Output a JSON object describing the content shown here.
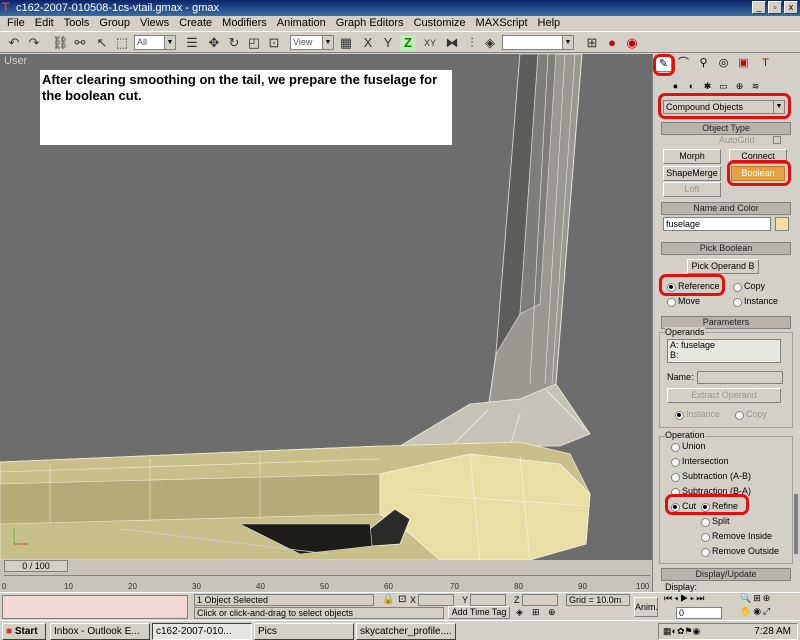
{
  "window": {
    "title": "c162-2007-010508-1cs-vtail.gmax - gmax",
    "minimize": "_",
    "maximize": "▫",
    "close": "x"
  },
  "menu": [
    "File",
    "Edit",
    "Tools",
    "Group",
    "Views",
    "Create",
    "Modifiers",
    "Animation",
    "Graph Editors",
    "Customize",
    "MAXScript",
    "Help"
  ],
  "toolbar": {
    "selection_filter": "All",
    "ref_coord": "View",
    "axis_labels": [
      "X",
      "Y",
      "Z",
      "XY"
    ]
  },
  "viewport": {
    "label": "User",
    "caption": "After clearing smoothing on the tail, we prepare the fuselage for the boolean cut."
  },
  "command_panel": {
    "category": "Compound Objects",
    "object_type": {
      "title": "Object Type",
      "autogrid": "AutoGrid",
      "buttons": [
        "Morph",
        "Connect",
        "ShapeMerge",
        "Boolean",
        "Loft"
      ]
    },
    "name_color": {
      "title": "Name and Color",
      "name": "fuselage"
    },
    "pick_boolean": {
      "title": "Pick Boolean",
      "pick_button": "Pick Operand B",
      "options": [
        "Reference",
        "Copy",
        "Move",
        "Instance"
      ]
    },
    "parameters": {
      "title": "Parameters",
      "operands_label": "Operands",
      "operands": [
        "A: fuselage",
        "B:"
      ],
      "name_label": "Name:",
      "extract_button": "Extract Operand",
      "extract_options": [
        "Instance",
        "Copy"
      ],
      "operation_label": "Operation",
      "operations": [
        "Union",
        "Intersection",
        "Subtraction (A-B)",
        "Subtraction (B-A)"
      ],
      "cut_label": "Cut",
      "cut_options": [
        "Refine",
        "Split",
        "Remove Inside",
        "Remove Outside"
      ]
    },
    "display_update": {
      "title": "Display/Update",
      "display_label": "Display:"
    }
  },
  "timeline": {
    "frame": "0 / 100",
    "ticks": [
      "0",
      "10",
      "20",
      "30",
      "40",
      "50",
      "60",
      "70",
      "80",
      "90",
      "100"
    ]
  },
  "status": {
    "selected": "1 Object Selected",
    "prompt": "Click or click-and-drag to select objects",
    "x_label": "X",
    "y_label": "Y",
    "z_label": "Z",
    "grid": "Grid = 10.0m",
    "add_time_tag": "Add Time Tag",
    "anim": "Anim.",
    "frame_field": "0"
  },
  "taskbar": {
    "start": "Start",
    "tasks": [
      "Inbox - Outlook E...",
      "c162-2007-010...",
      "Pics",
      "skycatcher_profile...."
    ],
    "clock": "7:28 AM"
  },
  "colors": {
    "highlight": "#e01010",
    "boolean_active": "#e3a245",
    "viewport_bg": "#6d6d6d"
  }
}
